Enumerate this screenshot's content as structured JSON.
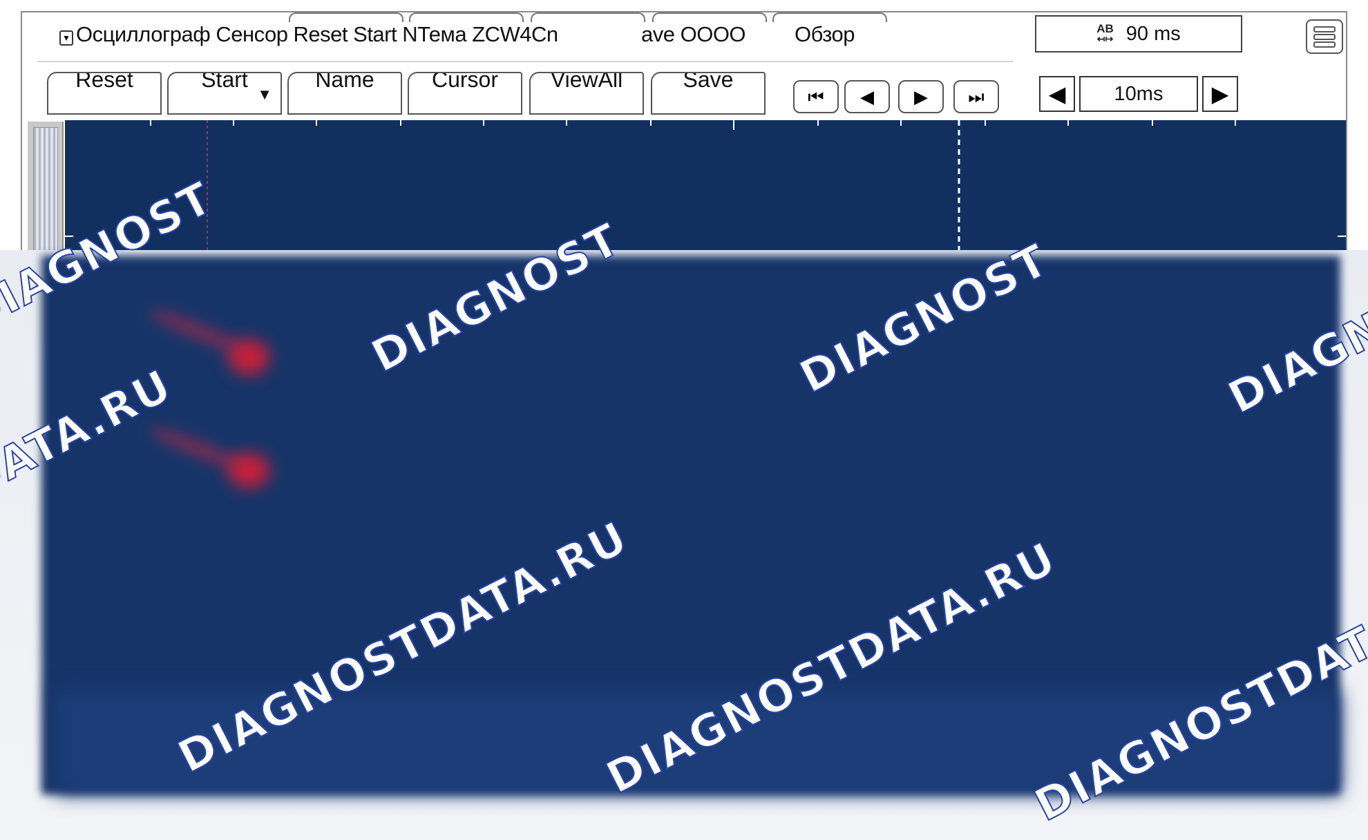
{
  "title_bar": {
    "text_main": "Осциллограф Сенсор Reset Start NТема ZCW4Cn",
    "text_mid": "ave OOOO",
    "text_right": "Обзор",
    "time_base_value": "90 ms",
    "time_base_icon": "ab-measure-icon",
    "menu_icon": "hamburger-menu-icon"
  },
  "toolbar": {
    "reset_label": "Reset",
    "start_label": "Start",
    "name_label": "Name",
    "cursor_label": "Cursor",
    "viewall_label": "ViewAll",
    "save_label": "Save",
    "nav_first": "⏮",
    "nav_prev": "◀",
    "nav_next": "▶",
    "nav_last": "⏭",
    "step_left": "◀",
    "step_value": "10ms",
    "step_right": "▶"
  },
  "scope": {
    "background": "#12305f",
    "cursor_a_color": "#d02040",
    "cursor_b_color": "#ffffff",
    "trace_color": "#c8203a"
  },
  "watermark": {
    "text_a": "DIAGNOST",
    "text_b": "DIAGNOSTDATA.RU"
  }
}
